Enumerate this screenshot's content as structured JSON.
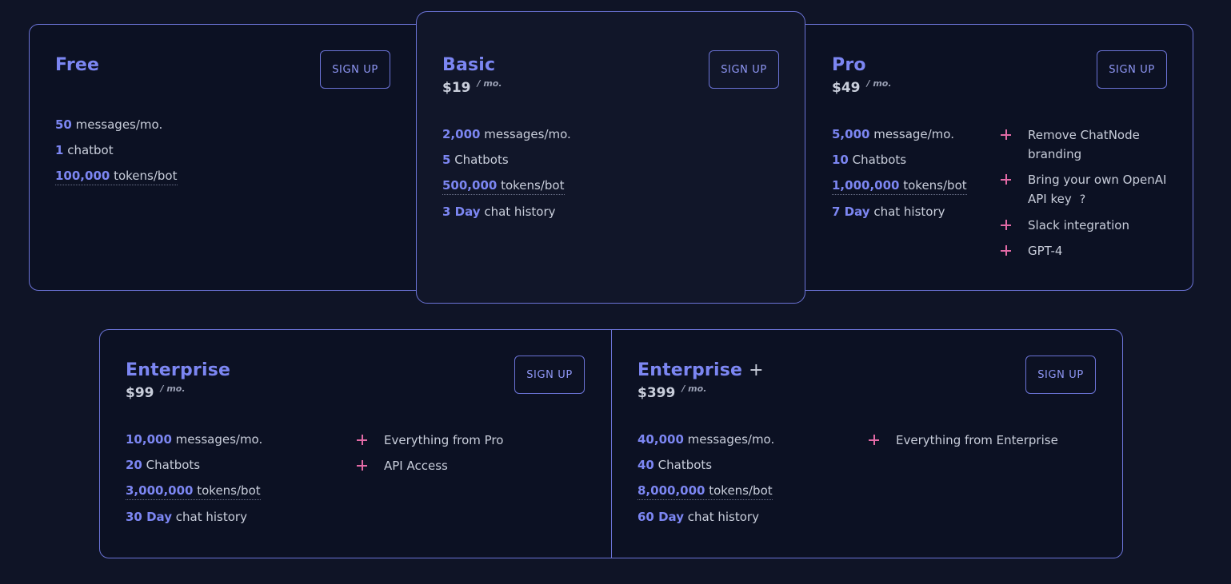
{
  "plans": {
    "free": {
      "name": "Free",
      "signup_label": "SIGN UP",
      "features": [
        {
          "num": "50",
          "text": " messages/mo."
        },
        {
          "num": "1",
          "text": " chatbot"
        },
        {
          "num": "100,000",
          "text": " tokens/bot"
        }
      ]
    },
    "basic": {
      "name": "Basic",
      "price": "$19",
      "per": "/ mo.",
      "signup_label": "SIGN UP",
      "features": [
        {
          "num": "2,000",
          "text": " messages/mo."
        },
        {
          "num": "5",
          "text": " Chatbots"
        },
        {
          "num": "500,000",
          "text": " tokens/bot"
        },
        {
          "num": "3 Day",
          "text": " chat history"
        }
      ]
    },
    "pro": {
      "name": "Pro",
      "price": "$49",
      "per": "/ mo.",
      "signup_label": "SIGN UP",
      "features": [
        {
          "num": "5,000",
          "text": " message/mo."
        },
        {
          "num": "10",
          "text": " Chatbots"
        },
        {
          "num": "1,000,000",
          "text": " tokens/bot"
        },
        {
          "num": "7 Day",
          "text": " chat history"
        }
      ],
      "extras": [
        "Remove ChatNode branding",
        "Bring your own OpenAI API key",
        "Slack integration",
        "GPT-4"
      ],
      "help_mark": "?"
    },
    "enterprise": {
      "name": "Enterprise",
      "price": "$99",
      "per": "/ mo.",
      "signup_label": "SIGN UP",
      "features": [
        {
          "num": "10,000",
          "text": " messages/mo."
        },
        {
          "num": "20",
          "text": " Chatbots"
        },
        {
          "num": "3,000,000",
          "text": " tokens/bot"
        },
        {
          "num": "30 Day",
          "text": " chat history"
        }
      ],
      "extras": [
        "Everything from Pro",
        "API Access"
      ]
    },
    "enterprise_plus": {
      "name": "Enterprise",
      "name_suffix": "+",
      "price": "$399",
      "per": "/ mo.",
      "signup_label": "SIGN UP",
      "features": [
        {
          "num": "40,000",
          "text": " messages/mo."
        },
        {
          "num": "40",
          "text": " Chatbots"
        },
        {
          "num": "8,000,000",
          "text": " tokens/bot"
        },
        {
          "num": "60 Day",
          "text": " chat history"
        }
      ],
      "extras": [
        "Everything from Enterprise"
      ]
    }
  },
  "colors": {
    "background": "#0f1426",
    "accent": "#7c86f2",
    "border": "#6b73d6",
    "plus": "#e36aa6",
    "text": "#c9cedb"
  }
}
